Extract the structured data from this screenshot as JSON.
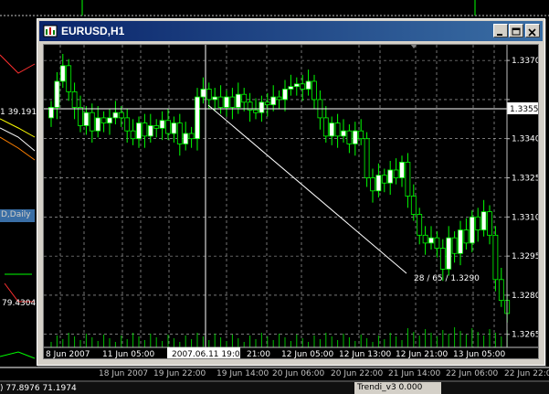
{
  "window": {
    "title": "EURUSD,H1"
  },
  "price_axis": {
    "labels": [
      "1.3370",
      "1.3355",
      "1.3340",
      "1.3325",
      "1.3310",
      "1.3295",
      "1.3280",
      "1.3265"
    ],
    "current_price": "1.3355"
  },
  "time_axis": {
    "labels": [
      "8 Jun 2007",
      "11 Jun 05:00",
      "21:00",
      "12 Jun 05:00",
      "12 Jun 13:00",
      "12 Jun 21:00",
      "13 Jun 05:00"
    ],
    "crosshair_time": "2007.06.11 19:00"
  },
  "trendline_label": "28 / 65 / 1.3290",
  "background": {
    "left_labels": [
      "1 39.1919",
      "D,Daily",
      "79.4304",
      ") 77.8976 71.1974"
    ],
    "bottom_labels": [
      "18 Jun 2007",
      "19 Jun 22:00",
      "19 Jun 14:00",
      "20 Jun 06:00",
      "20 Jun 22:00",
      "21 Jun 14:00",
      "22 Jun 06:00",
      "22 Jun 22:00"
    ],
    "tab_label": "Trendi_v3 0.000"
  },
  "colors": {
    "bull_body": "#ffffff",
    "bear_body": "#000000",
    "wick": "#00ff00",
    "grid": "#c0c0c0",
    "volume": "#00c000"
  }
}
